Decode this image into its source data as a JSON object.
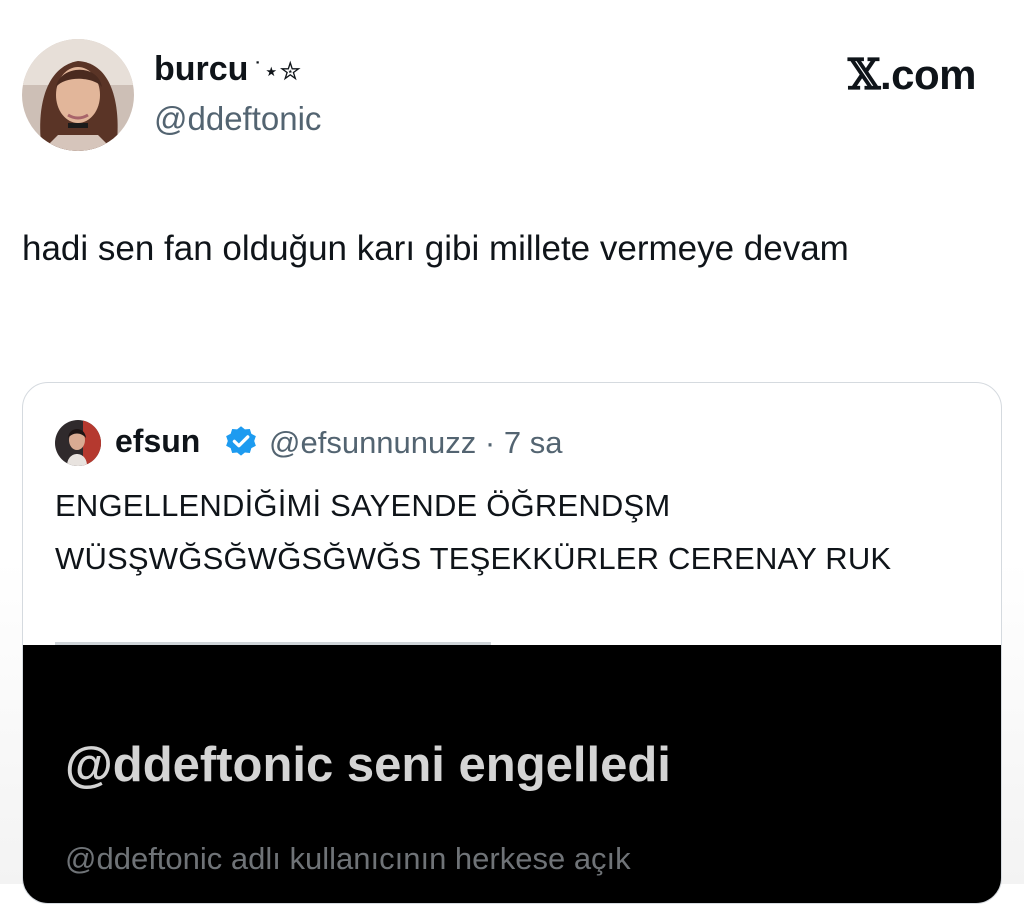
{
  "header": {
    "display_name": "burcu",
    "name_decoration": "˙⋆✮",
    "handle": "@ddeftonic",
    "brand": {
      "mark": "𝕏",
      "suffix": ".com"
    }
  },
  "tweet": {
    "text": "hadi sen fan olduğun karı gibi millete vermeye devam"
  },
  "quoted_tweet": {
    "display_name": "efsun",
    "verified": true,
    "handle": "@efsunnunuzz",
    "separator": "·",
    "time": "7 sa",
    "text": "ENGELLENDİĞİMİ SAYENDE ÖĞRENDŞM WÜSŞWĞSĞWĞSĞWĞS TEŞEKKÜRLER CERENAY RUK",
    "media": {
      "title": "@ddeftonic seni engelledi",
      "subtitle": "@ddeftonic adlı kullanıcının herkese açık"
    }
  },
  "colors": {
    "text_primary": "#0f1419",
    "text_secondary": "#536471",
    "verified_blue": "#1d9bf0",
    "card_border": "#d5dadf",
    "media_background": "#000000"
  },
  "icons": {
    "avatar": "profile-photo",
    "quoted_avatar": "profile-photo",
    "verified": "verified-badge-icon"
  }
}
